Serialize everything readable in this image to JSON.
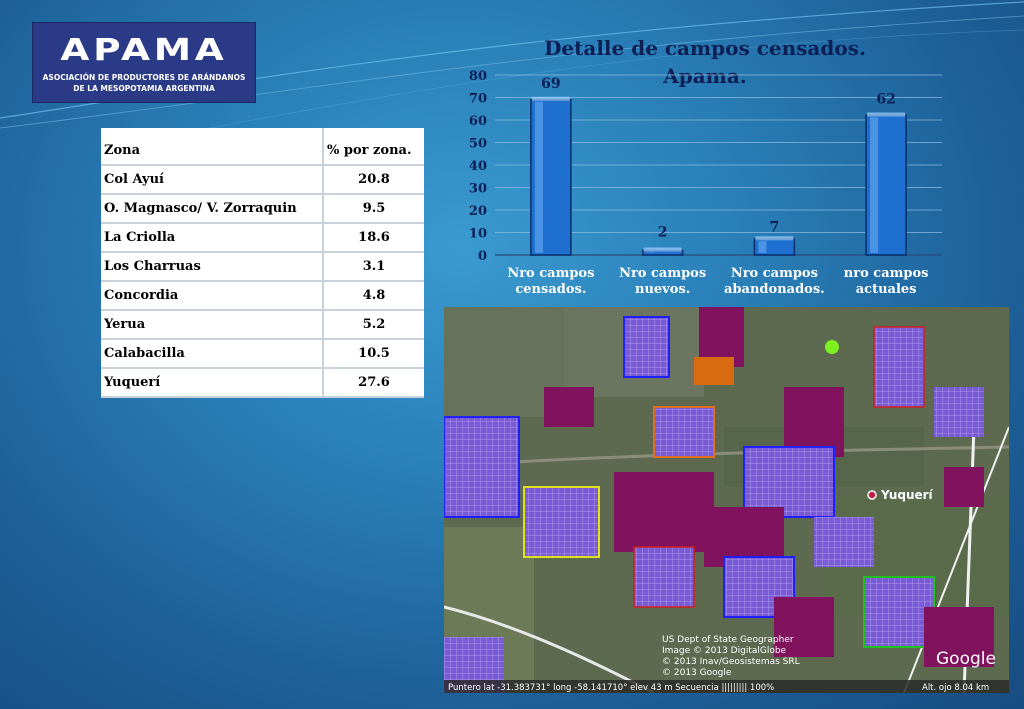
{
  "logo": {
    "word": "APAMA",
    "subtitle_line1": "ASOCIACIÓN DE PRODUCTORES DE ARÁNDANOS",
    "subtitle_line2": "DE LA MESOPOTAMIA ARGENTINA"
  },
  "title_line1": "Detalle de campos censados.",
  "title_line2": "Apama.",
  "table": {
    "headers": [
      "Zona",
      "% por zona."
    ],
    "rows": [
      {
        "zona": "Col Ayuí",
        "pct": "20.8"
      },
      {
        "zona": "O. Magnasco/ V. Zorraquin",
        "pct": "9.5"
      },
      {
        "zona": "La Criolla",
        "pct": "18.6"
      },
      {
        "zona": "Los Charruas",
        "pct": "3.1"
      },
      {
        "zona": "Concordia",
        "pct": "4.8"
      },
      {
        "zona": "Yerua",
        "pct": "5.2"
      },
      {
        "zona": "Calabacilla",
        "pct": "10.5"
      },
      {
        "zona": "Yuquerí",
        "pct": "27.6"
      }
    ]
  },
  "chart_data": {
    "type": "bar",
    "title": "Detalle de campos censados. Apama.",
    "categories": [
      [
        "Nro campos",
        "censados."
      ],
      [
        "Nro campos",
        "nuevos."
      ],
      [
        "Nro campos",
        "abandonados."
      ],
      [
        "nro campos",
        "actuales"
      ]
    ],
    "values": [
      69,
      2,
      7,
      62
    ],
    "ylim": [
      0,
      80
    ],
    "yticks": [
      0,
      10,
      20,
      30,
      40,
      50,
      60,
      70,
      80
    ],
    "grid": true,
    "bar_color": "#1f6fd0"
  },
  "map": {
    "place_label": "Yuquerí",
    "attribution": [
      "US Dept of State Geographer",
      "Image © 2013 DigitalGlobe",
      "© 2013 Inav/Geosistemas SRL",
      "© 2013 Google"
    ],
    "google_label": "Google",
    "status_bar": "Puntero   lat  -31.383731°     long  -58.141710°     elev   43 m Secuencia ||||||||| 100%",
    "status_alt": "Alt. ojo      8.04 km"
  }
}
